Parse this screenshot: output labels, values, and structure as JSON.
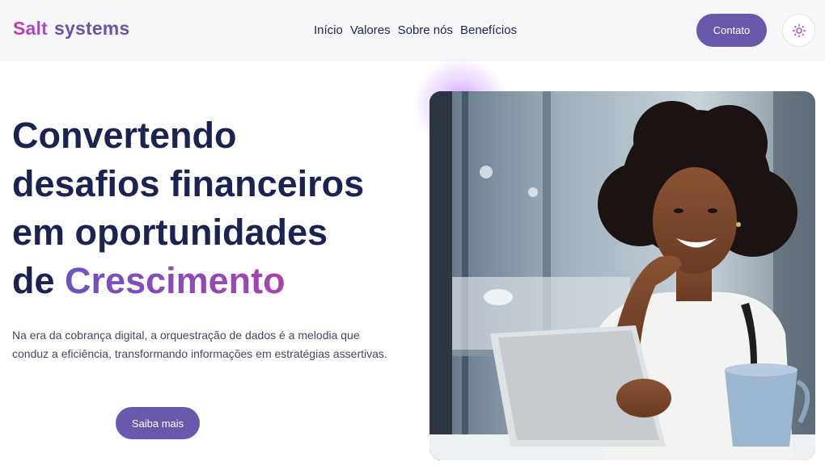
{
  "brand": {
    "part1": "Salt",
    "part2": "systems"
  },
  "nav": {
    "items": [
      "Início",
      "Valores",
      "Sobre nós",
      "Benefícios"
    ]
  },
  "header": {
    "contact_label": "Contato",
    "theme_icon": "sun-icon"
  },
  "hero": {
    "title_lines": [
      "Convertendo",
      "desafios financeiros",
      "em oportunidades"
    ],
    "title_prefix": "de ",
    "title_accent": "Crescimento",
    "description": "Na era da cobrança digital, a orquestração de dados é a melodia que conduz a eficiência, transformando informações em estratégias assertivas.",
    "cta_label": "Saiba mais"
  },
  "colors": {
    "primary": "#6a58ac",
    "heading": "#1c2350",
    "accent_start": "#6c52c0",
    "accent_end": "#a744ae",
    "logo_pink": "#c535b8"
  }
}
